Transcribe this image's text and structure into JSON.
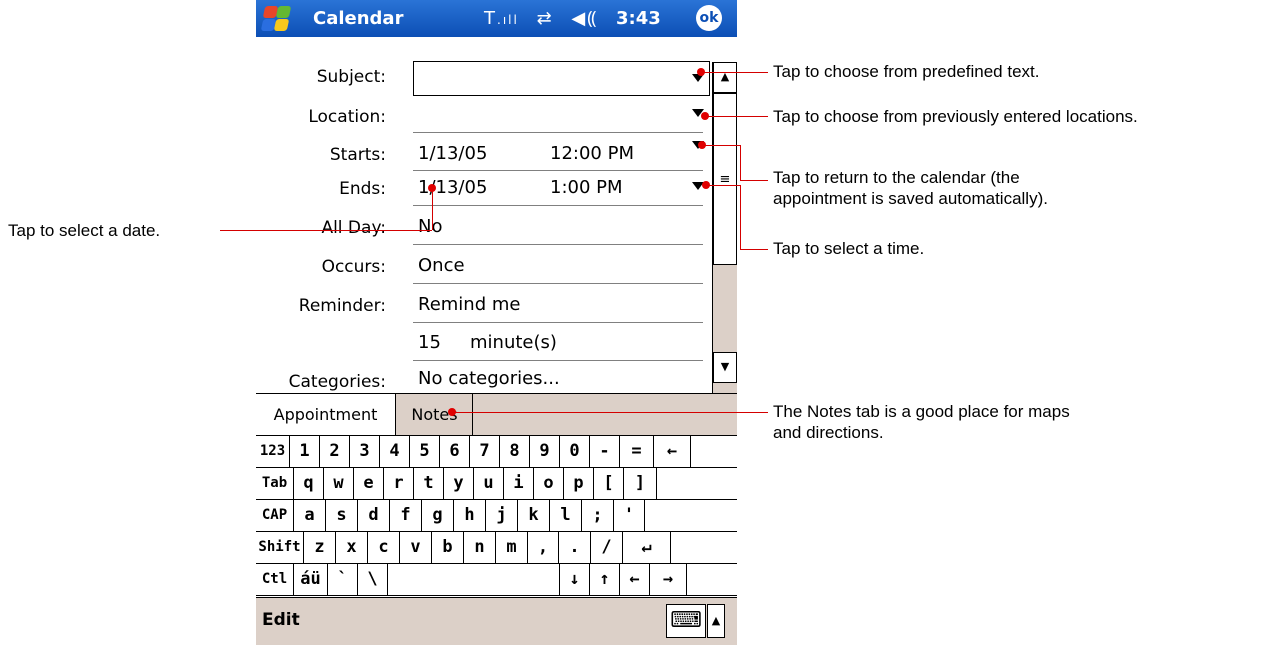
{
  "titlebar": {
    "app_title": "Calendar",
    "status_icons": "T.ıll ⇄ ◀⦅",
    "clock": "3:43",
    "ok_label": "ok"
  },
  "form": {
    "subject": {
      "label": "Subject:",
      "value": ""
    },
    "location": {
      "label": "Location:",
      "value": ""
    },
    "starts": {
      "label": "Starts:",
      "date": "1/13/05",
      "time": "12:00 PM"
    },
    "ends": {
      "label": "Ends:",
      "date": "1/13/05",
      "time": "1:00 PM"
    },
    "all_day": {
      "label": "All Day:",
      "value": "No"
    },
    "occurs": {
      "label": "Occurs:",
      "value": "Once"
    },
    "reminder": {
      "label": "Reminder:",
      "value": "Remind me",
      "amount": "15",
      "unit": "minute(s)"
    },
    "categories": {
      "label": "Categories:",
      "value": "No categories..."
    }
  },
  "tabs": [
    {
      "label": "Appointment",
      "active": true
    },
    {
      "label": "Notes",
      "active": false
    }
  ],
  "keyboard": {
    "rows": [
      [
        "123",
        "1",
        "2",
        "3",
        "4",
        "5",
        "6",
        "7",
        "8",
        "9",
        "0",
        "-",
        "=",
        "←"
      ],
      [
        "Tab",
        "q",
        "w",
        "e",
        "r",
        "t",
        "y",
        "u",
        "i",
        "o",
        "p",
        "[",
        "]"
      ],
      [
        "CAP",
        "a",
        "s",
        "d",
        "f",
        "g",
        "h",
        "j",
        "k",
        "l",
        ";",
        "'"
      ],
      [
        "Shift",
        "z",
        "x",
        "c",
        "v",
        "b",
        "n",
        "m",
        ",",
        ".",
        "/",
        "↵"
      ],
      [
        "Ctl",
        "áü",
        "`",
        "\\",
        "",
        "↓",
        "↑",
        "←",
        "→"
      ]
    ]
  },
  "menubar": {
    "edit_label": "Edit",
    "keyboard_icon": "keyboard-icon",
    "sip_arrow": "▲"
  },
  "callouts": {
    "predefined_text": "Tap to choose from predefined text.",
    "previous_locations": "Tap to choose from previously entered locations.",
    "return_calendar_line1": "Tap to return to the calendar (the",
    "return_calendar_line2": "appointment is saved automatically).",
    "select_time": "Tap to select a time.",
    "select_date": "Tap to select a date.",
    "notes_tab_line1": "The Notes tab is a good place for maps",
    "notes_tab_line2": "and directions."
  },
  "colors": {
    "titlebar": "#0c4fb5",
    "chrome": "#dcd0c8",
    "callout_line": "#d40000"
  }
}
